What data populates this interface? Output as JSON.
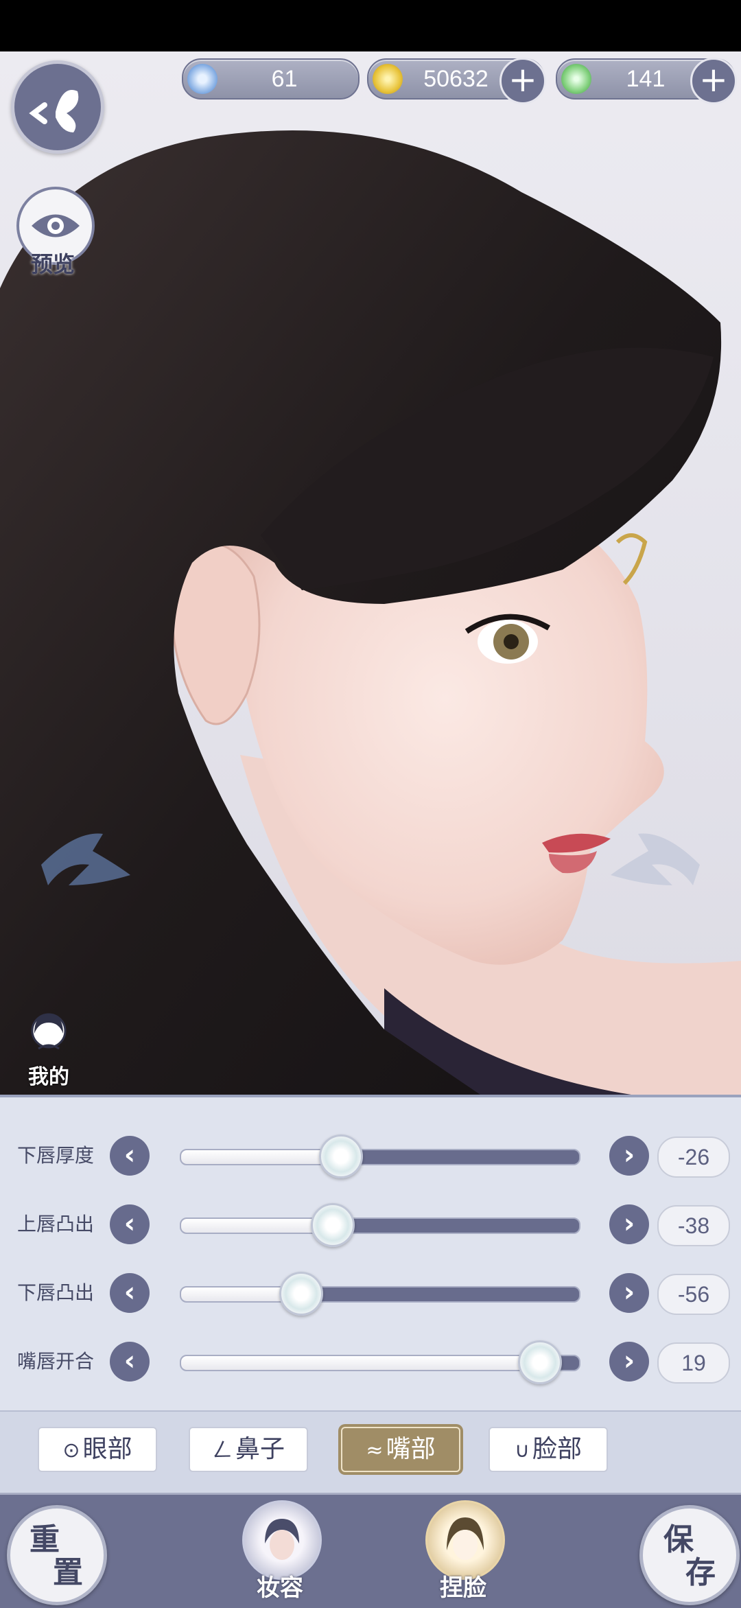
{
  "currencies": [
    {
      "name": "jade",
      "value": "61",
      "icon": "wave-coin-icon",
      "has_plus": false
    },
    {
      "name": "copper",
      "value": "50632",
      "icon": "coin-icon",
      "has_plus": true
    },
    {
      "name": "green",
      "value": "141",
      "icon": "dragon-coin-icon",
      "has_plus": true
    }
  ],
  "preview_label": "预览",
  "mine_label": "我的",
  "sliders": [
    {
      "label": "下唇厚度",
      "value": "-26",
      "level": 0.4
    },
    {
      "label": "上唇凸出",
      "value": "-38",
      "level": 0.38
    },
    {
      "label": "下唇凸出",
      "value": "-56",
      "level": 0.3
    },
    {
      "label": "嘴唇开合",
      "value": "19",
      "level": 0.9
    }
  ],
  "tabs": [
    {
      "icon": "⊙",
      "label": "眼部",
      "active": false
    },
    {
      "icon": "ㄥ",
      "label": "鼻子",
      "active": false
    },
    {
      "icon": "≈",
      "label": "嘴部",
      "active": true
    },
    {
      "icon": "∪",
      "label": "脸部",
      "active": false
    }
  ],
  "bottom": {
    "reset": [
      "重",
      "置"
    ],
    "makeup": "妆容",
    "face": "捏脸",
    "save": [
      "保",
      "存"
    ]
  },
  "colors": {
    "accent": "#6c7090",
    "gold": "#a08d66"
  }
}
